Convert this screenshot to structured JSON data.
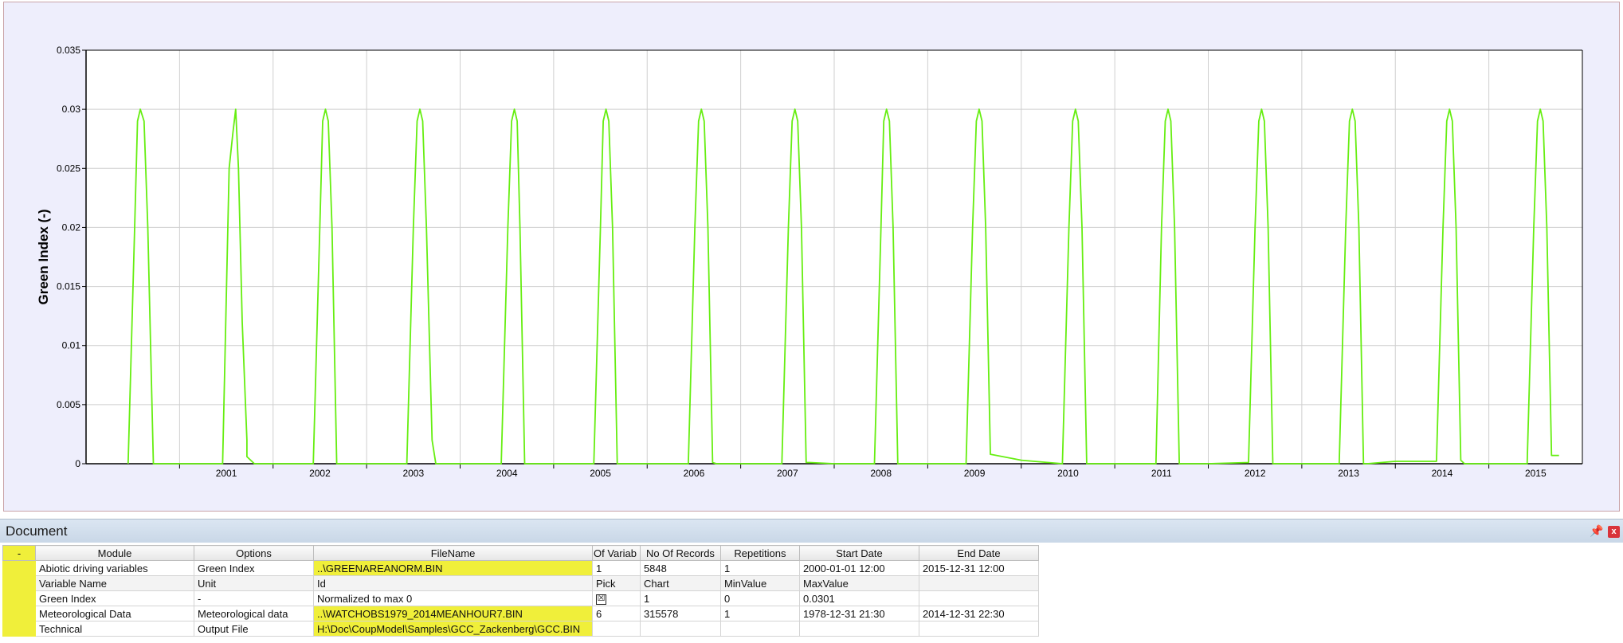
{
  "chart_data": {
    "type": "line",
    "title": "",
    "xlabel": "",
    "ylabel": "Green Index (-)",
    "ylim": [
      0,
      0.035
    ],
    "yticks": [
      "0",
      "0.005",
      "0.01",
      "0.015",
      "0.02",
      "0.025",
      "0.03",
      "0.035"
    ],
    "xlim": [
      2000.0,
      2016.0
    ],
    "xtick_labels": [
      "2001",
      "2002",
      "2003",
      "2004",
      "2005",
      "2006",
      "2007",
      "2008",
      "2009",
      "2010",
      "2011",
      "2012",
      "2013",
      "2014",
      "2015"
    ],
    "grid": true,
    "series": [
      {
        "color": "#66ee11",
        "x": [
          2000.45,
          2000.52,
          2000.55,
          2000.58,
          2000.62,
          2000.66,
          2000.72,
          2000.82,
          2001.0,
          2001.15,
          2001.46,
          2001.53,
          2001.57,
          2001.6,
          2001.63,
          2001.67,
          2001.72,
          2001.72,
          2001.8,
          2001.9,
          2002.1,
          2002.43,
          2002.5,
          2002.53,
          2002.56,
          2002.59,
          2002.63,
          2002.68,
          2002.72,
          2003.0,
          2003.43,
          2003.5,
          2003.54,
          2003.57,
          2003.6,
          2003.64,
          2003.7,
          2003.74,
          2004.0,
          2004.44,
          2004.51,
          2004.55,
          2004.58,
          2004.61,
          2004.64,
          2004.69,
          2004.73,
          2005.0,
          2005.43,
          2005.5,
          2005.53,
          2005.56,
          2005.59,
          2005.63,
          2005.68,
          2005.73,
          2006.0,
          2006.44,
          2006.51,
          2006.55,
          2006.58,
          2006.61,
          2006.65,
          2006.7,
          2006.74,
          2007.0,
          2007.44,
          2007.51,
          2007.55,
          2007.58,
          2007.61,
          2007.65,
          2007.7,
          2007.74,
          2008.0,
          2008.43,
          2008.5,
          2008.53,
          2008.56,
          2008.59,
          2008.63,
          2008.68,
          2008.72,
          2009.0,
          2009.41,
          2009.48,
          2009.52,
          2009.55,
          2009.58,
          2009.62,
          2009.67,
          2009.67,
          2010.0,
          2010.44,
          2010.51,
          2010.55,
          2010.58,
          2010.61,
          2010.65,
          2010.7,
          2010.74,
          2011.0,
          2011.44,
          2011.5,
          2011.54,
          2011.57,
          2011.6,
          2011.64,
          2011.69,
          2011.72,
          2012.0,
          2012.43,
          2012.5,
          2012.54,
          2012.57,
          2012.6,
          2012.64,
          2012.69,
          2012.72,
          2013.0,
          2013.4,
          2013.47,
          2013.51,
          2013.54,
          2013.57,
          2013.61,
          2013.66,
          2013.7,
          2014.0,
          2014.44,
          2014.51,
          2014.55,
          2014.58,
          2014.61,
          2014.65,
          2014.7,
          2014.74,
          2015.0,
          2015.41,
          2015.48,
          2015.52,
          2015.55,
          2015.58,
          2015.62,
          2015.67,
          2015.67,
          2015.75
        ],
        "y": [
          0,
          0.02,
          0.029,
          0.03,
          0.029,
          0.02,
          0,
          0,
          0,
          0,
          0,
          0.025,
          0.028,
          0.03,
          0.025,
          0.012,
          0.002,
          0.0006,
          0,
          0,
          0,
          0,
          0.02,
          0.029,
          0.03,
          0.029,
          0.02,
          0,
          0,
          0,
          0,
          0.02,
          0.029,
          0.03,
          0.029,
          0.02,
          0.002,
          0,
          0,
          0,
          0.02,
          0.029,
          0.03,
          0.029,
          0.02,
          0,
          0,
          0,
          0,
          0.02,
          0.029,
          0.03,
          0.029,
          0.02,
          0,
          0,
          0,
          0,
          0.02,
          0.029,
          0.03,
          0.029,
          0.02,
          0.0001,
          0,
          0,
          0,
          0.02,
          0.029,
          0.03,
          0.029,
          0.02,
          0.0001,
          0.0001,
          0,
          0,
          0.02,
          0.029,
          0.03,
          0.029,
          0.02,
          0,
          0,
          0,
          0,
          0.02,
          0.029,
          0.03,
          0.029,
          0.02,
          0.0008,
          0.0008,
          0.0003,
          0,
          0.02,
          0.029,
          0.03,
          0.029,
          0.02,
          0,
          0,
          0,
          0,
          0.02,
          0.029,
          0.03,
          0.029,
          0.02,
          0,
          0,
          0,
          0.0001,
          0.02,
          0.029,
          0.03,
          0.029,
          0.02,
          0,
          0,
          0,
          0,
          0.02,
          0.029,
          0.03,
          0.029,
          0.02,
          0,
          0,
          0.0002,
          0.0002,
          0.02,
          0.029,
          0.03,
          0.029,
          0.02,
          0.0003,
          0,
          0,
          0,
          0.02,
          0.029,
          0.03,
          0.029,
          0.02,
          0.0007,
          0.0007,
          0.0007
        ]
      }
    ]
  },
  "document": {
    "title": "Document",
    "pin_icon": "pin-icon",
    "close_icon": "close-icon",
    "close_label": "x",
    "columns": [
      "-",
      "Module",
      "Options",
      "FileName",
      "Of Variab",
      "No Of Records",
      "Repetitions",
      "Start Date",
      "End Date"
    ],
    "rows": [
      {
        "cells": [
          "Abiotic driving variables",
          "Green Index",
          "..\\GREENAREANORM.BIN",
          "1",
          "5848",
          "1",
          "2000-01-01 12:00",
          "2015-12-31 12:00"
        ],
        "sub": false
      },
      {
        "cells": [
          "Variable Name",
          "Unit",
          "Id",
          "Pick",
          "Chart",
          "MinValue",
          "MaxValue",
          ""
        ],
        "sub": true
      },
      {
        "cells": [
          "Green Index",
          "-",
          "Normalized to max 0",
          "☒",
          "1",
          "0",
          "0.0301",
          ""
        ],
        "sub": false
      },
      {
        "cells": [
          "Meteorological Data",
          "Meteorological data",
          "..\\WATCHOBS1979_2014MEANHOUR7.BIN",
          "6",
          "315578",
          "1",
          "1978-12-31 21:30",
          "2014-12-31 22:30"
        ],
        "sub": false
      },
      {
        "cells": [
          "Technical",
          "Output File",
          "H:\\Doc\\CoupModel\\Samples\\GCC_Zackenberg\\GCC.BIN",
          "",
          "",
          "",
          "",
          ""
        ],
        "sub": false
      }
    ]
  }
}
